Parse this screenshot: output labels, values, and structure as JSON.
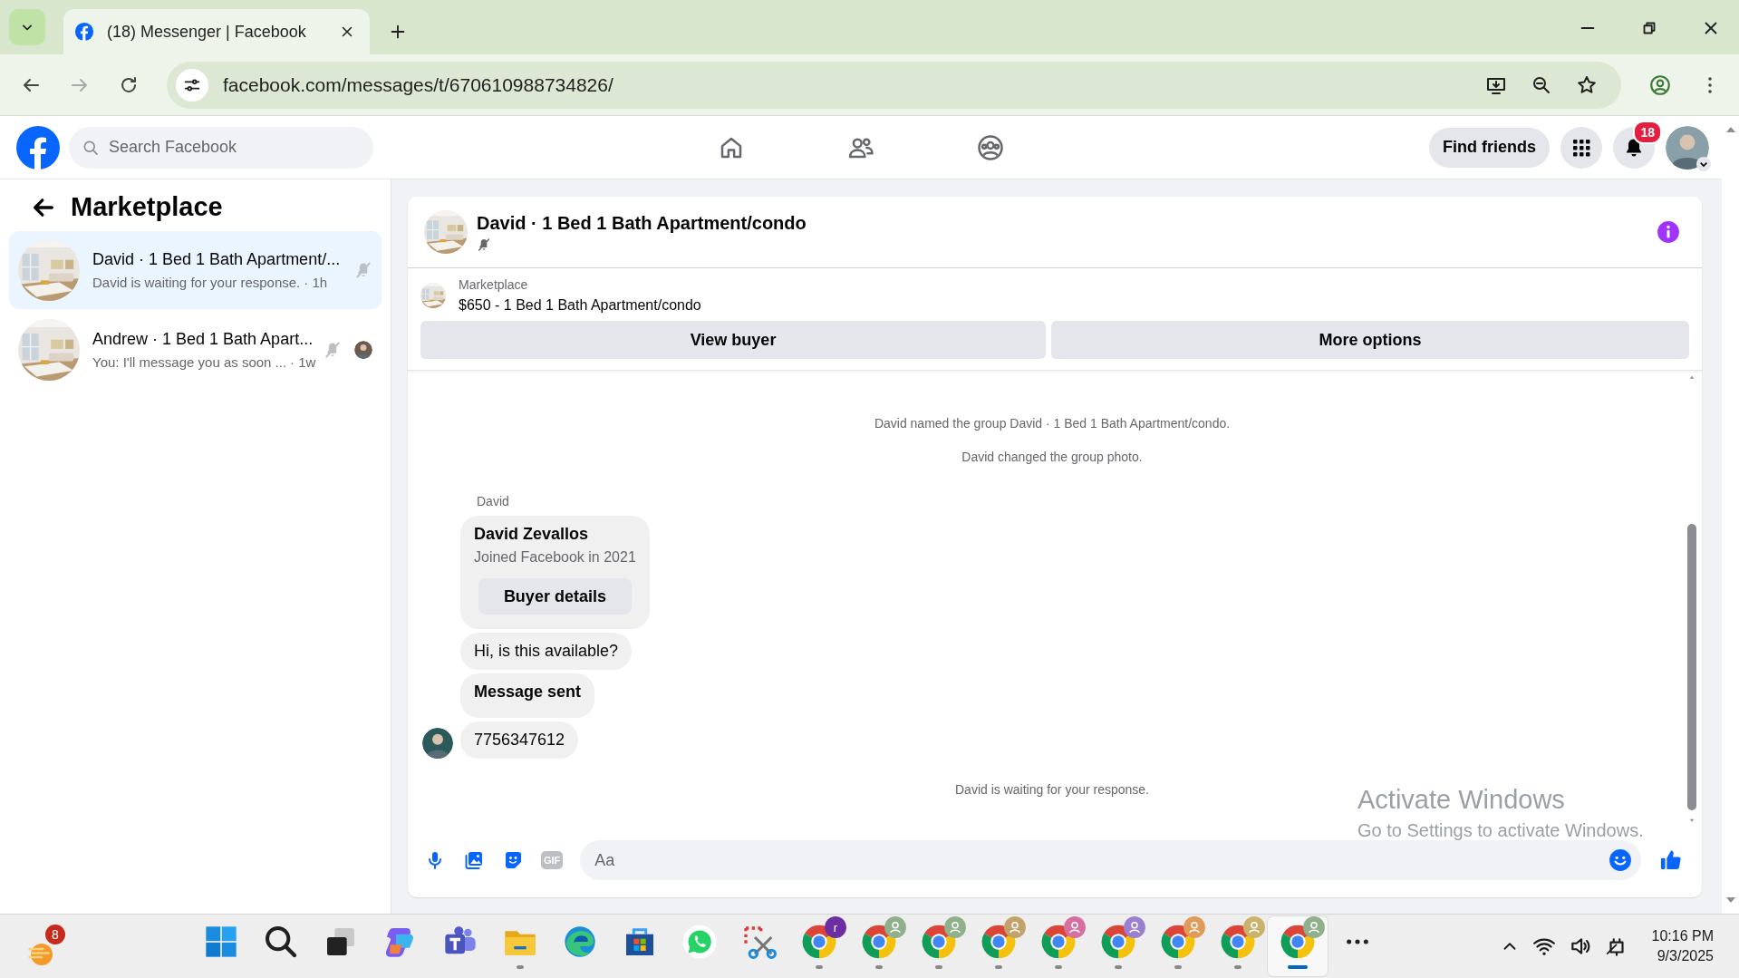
{
  "browser": {
    "tab": {
      "title": "(18) Messenger | Facebook"
    },
    "url": "facebook.com/messages/t/670610988734826/"
  },
  "facebook_header": {
    "search": {
      "placeholder": "Search Facebook"
    },
    "nav": [
      {
        "kind": "home"
      },
      {
        "kind": "friends"
      },
      {
        "kind": "groups"
      }
    ],
    "find_friends": "Find friends",
    "notifications_badge": "18"
  },
  "sidebar": {
    "title": "Marketplace",
    "conversations": [
      {
        "title": "David · 1 Bed 1 Bath Apartment/...",
        "preview": "David is waiting for your response.",
        "time": "· 1h",
        "selected": true,
        "muted": true,
        "seen": false
      },
      {
        "title": "Andrew · 1 Bed 1 Bath Apart...",
        "preview": "You: I'll message you as soon ...",
        "time": "· 1w",
        "selected": false,
        "muted": true,
        "seen": true
      }
    ]
  },
  "chat": {
    "title": "David · 1 Bed 1 Bath Apartment/condo",
    "muted": true,
    "listing": {
      "label": "Marketplace",
      "title": "$650 - 1 Bed 1 Bath Apartment/condo"
    },
    "actions": [
      "View buyer",
      "More options"
    ],
    "events": [
      "David named the group David · 1 Bed 1 Bath Apartment/condo.",
      "David changed the group photo."
    ],
    "sender": "David",
    "messages": [
      {
        "kind": "profile_card",
        "name": "David Zevallos",
        "subtitle": "Joined Facebook in 2021",
        "button": "Buyer details",
        "avatar": false
      },
      {
        "kind": "text",
        "text": "Hi, is this available?",
        "avatar": false
      },
      {
        "kind": "notice",
        "text": "Message sent",
        "avatar": false
      },
      {
        "kind": "text",
        "text": "7756347612",
        "avatar": true
      }
    ],
    "status": "David is waiting for your response.",
    "composer": {
      "placeholder": "Aa",
      "gif_label": "GIF"
    }
  },
  "windows_overlay": {
    "title": "Activate Windows",
    "subtitle": "Go to Settings to activate Windows."
  },
  "taskbar": {
    "widgets_badge": "8",
    "apps": [
      {
        "kind": "start",
        "running": false,
        "selected": false
      },
      {
        "kind": "search",
        "running": false,
        "selected": false
      },
      {
        "kind": "taskview",
        "running": false,
        "selected": false
      },
      {
        "kind": "copilot",
        "running": false,
        "selected": false
      },
      {
        "kind": "teams",
        "running": false,
        "selected": false
      },
      {
        "kind": "explorer",
        "running": true,
        "selected": false
      },
      {
        "kind": "edge",
        "running": false,
        "selected": false
      },
      {
        "kind": "store",
        "running": false,
        "selected": false
      },
      {
        "kind": "whatsapp",
        "running": false,
        "selected": false
      },
      {
        "kind": "snipping",
        "running": false,
        "selected": false
      },
      {
        "kind": "chrome",
        "running": true,
        "selected": false,
        "profile_letter": "r",
        "color": "#6b2fa3"
      },
      {
        "kind": "chrome",
        "running": true,
        "selected": false,
        "color": "#8fb08a"
      },
      {
        "kind": "chrome",
        "running": true,
        "selected": false,
        "color": "#8fb08a"
      },
      {
        "kind": "chrome",
        "running": true,
        "selected": false,
        "color": "#c2a26b"
      },
      {
        "kind": "chrome",
        "running": true,
        "selected": false,
        "color": "#d66fa0"
      },
      {
        "kind": "chrome",
        "running": true,
        "selected": false,
        "color": "#9b7fd0"
      },
      {
        "kind": "chrome",
        "running": true,
        "selected": false,
        "color": "#e09a5a"
      },
      {
        "kind": "chrome",
        "running": true,
        "selected": false,
        "color": "#c9b36b"
      },
      {
        "kind": "chrome",
        "running": true,
        "selected": true,
        "color": "#8fb08a"
      },
      {
        "kind": "more",
        "running": false,
        "selected": false
      }
    ],
    "time": "10:16 PM",
    "date": "9/3/2025"
  }
}
